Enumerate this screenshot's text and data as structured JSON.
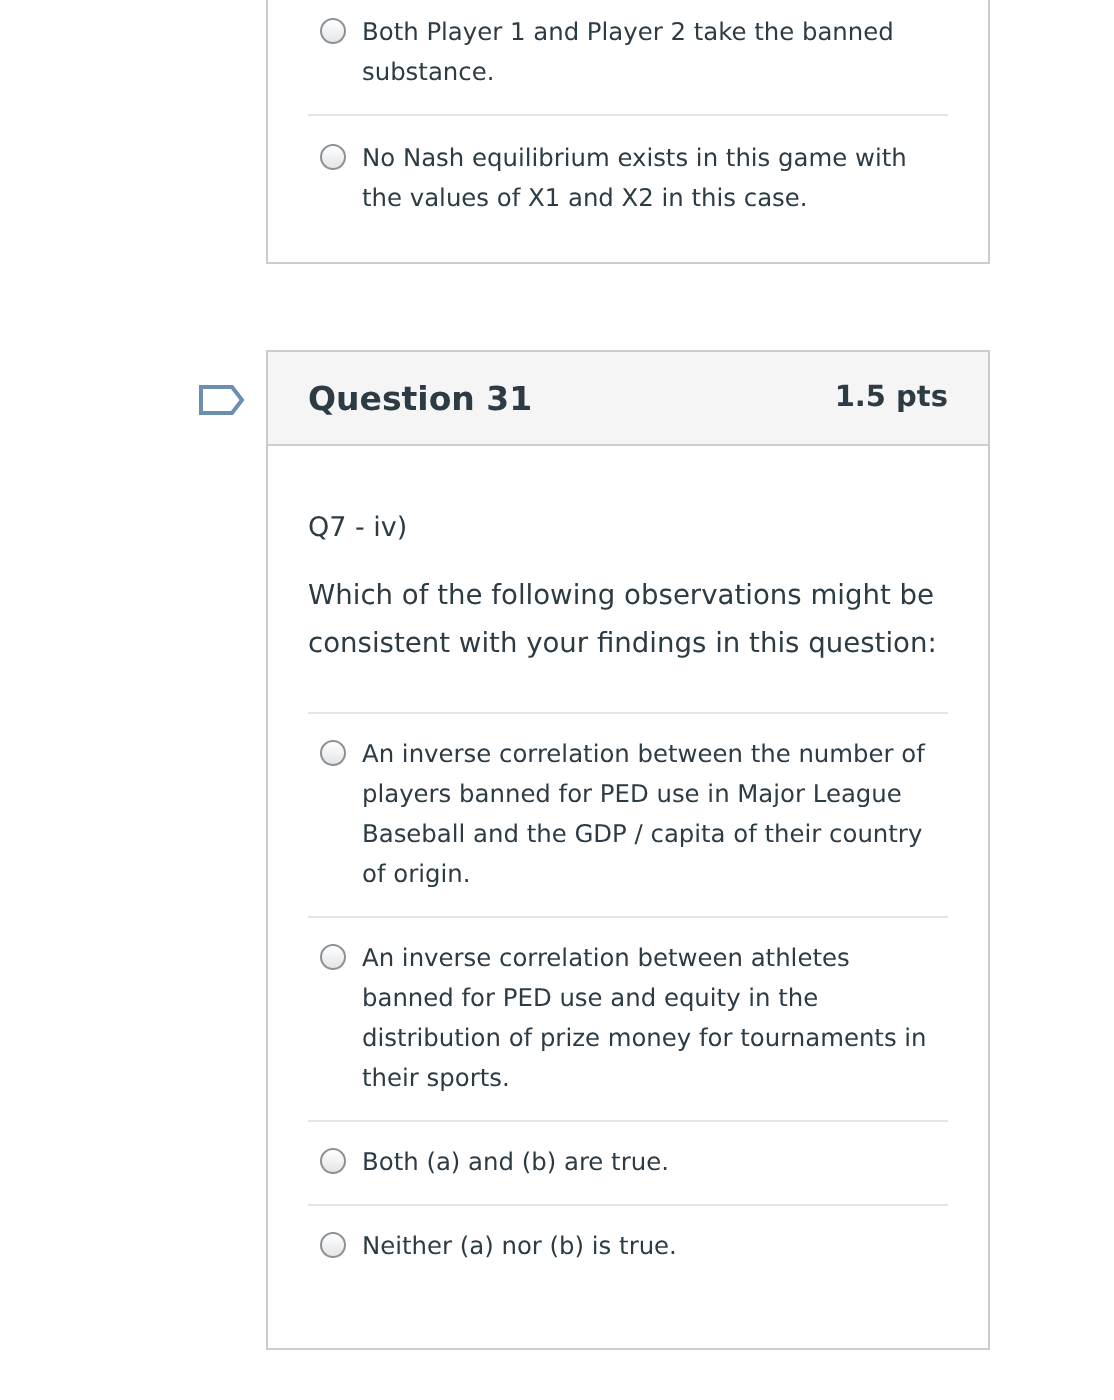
{
  "previous_question": {
    "answers": [
      {
        "text": "Both Player 1 and Player 2 take the banned substance.",
        "selected": false
      },
      {
        "text": "No Nash equilibrium exists in this game with the values of X1 and X2 in this case.",
        "selected": false
      }
    ]
  },
  "question": {
    "flagged": false,
    "title": "Question 31",
    "points": "1.5 pts",
    "label": "Q7 - iv)",
    "prompt": "Which of the following observations might be consistent with your findings in this question:",
    "answers": [
      {
        "text": "An inverse correlation between the number of players banned for PED use in Major League Baseball and the GDP / capita of their country of origin.",
        "selected": false
      },
      {
        "text": "An inverse correlation between athletes banned for PED use and equity in the distribution of prize money for tournaments in their sports.",
        "selected": false
      },
      {
        "text": "Both (a) and (b) are true.",
        "selected": false
      },
      {
        "text": "Neither (a) nor (b) is true.",
        "selected": false
      }
    ]
  }
}
